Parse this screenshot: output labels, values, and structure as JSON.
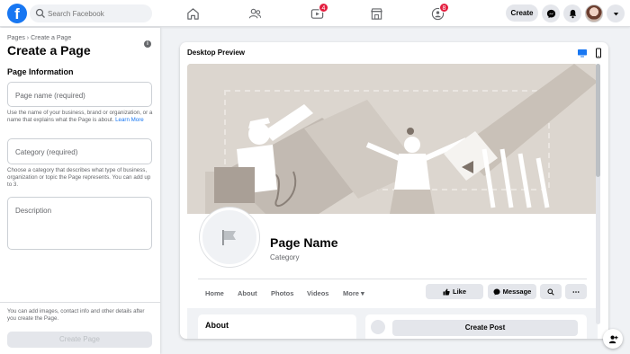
{
  "topbar": {
    "logo": "f",
    "search_placeholder": "Search Facebook",
    "nav": [
      {
        "name": "home",
        "icon": "home-icon",
        "badge": ""
      },
      {
        "name": "friends",
        "icon": "friends-icon",
        "badge": ""
      },
      {
        "name": "watch",
        "icon": "watch-icon",
        "badge": "4"
      },
      {
        "name": "marketplace",
        "icon": "marketplace-icon",
        "badge": ""
      },
      {
        "name": "groups",
        "icon": "groups-icon",
        "badge": "8"
      }
    ],
    "create_label": "Create"
  },
  "left": {
    "breadcrumb": "Pages › Create a Page",
    "title": "Create a Page",
    "info_icon": "i",
    "section_label": "Page Information",
    "page_name_placeholder": "Page name (required)",
    "page_name_help": "Use the name of your business, brand or organization, or a name that explains what the Page is about.",
    "learn_more": "Learn More",
    "category_placeholder": "Category (required)",
    "category_help": "Choose a category that describes what type of business, organization or topic the Page represents. You can add up to 3.",
    "description_placeholder": "Description",
    "footer_text": "You can add images, contact info and other details after you create the Page.",
    "create_button": "Create Page"
  },
  "preview": {
    "title": "Desktop Preview",
    "page_name": "Page Name",
    "category": "Category",
    "tabs": [
      "Home",
      "About",
      "Photos",
      "Videos",
      "More ▾"
    ],
    "like_label": "Like",
    "message_label": "Message",
    "about_title": "About",
    "create_post_label": "Create Post"
  },
  "colors": {
    "brand": "#1877f2",
    "badge": "#e41e3f"
  }
}
